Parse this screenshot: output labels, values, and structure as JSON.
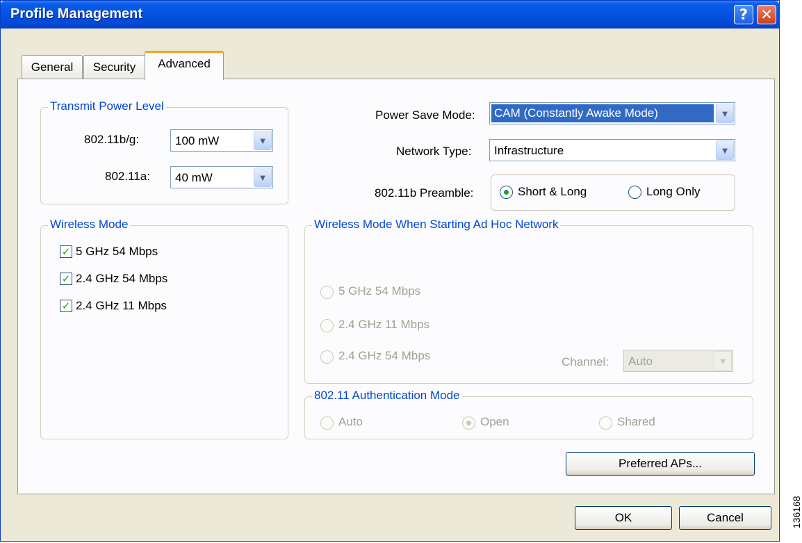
{
  "window": {
    "title": "Profile Management",
    "help_label": "?",
    "close_label": "✕"
  },
  "tabs": [
    {
      "label": "General"
    },
    {
      "label": "Security"
    },
    {
      "label": "Advanced",
      "active": true
    }
  ],
  "transmit_power": {
    "title": "Transmit Power Level",
    "bg_label": "802.11b/g:",
    "bg_value": "100 mW",
    "a_label": "802.11a:",
    "a_value": "40 mW"
  },
  "power_save": {
    "label": "Power Save Mode:",
    "value": "CAM (Constantly Awake Mode)"
  },
  "network_type": {
    "label": "Network Type:",
    "value": "Infrastructure"
  },
  "preamble": {
    "label": "802.11b Preamble:",
    "options": [
      {
        "label": "Short & Long",
        "checked": true
      },
      {
        "label": "Long Only",
        "checked": false
      }
    ]
  },
  "wireless_mode": {
    "title": "Wireless Mode",
    "items": [
      {
        "label": "5 GHz 54 Mbps",
        "checked": true
      },
      {
        "label": "2.4 GHz 54 Mbps",
        "checked": true
      },
      {
        "label": "2.4 GHz 11 Mbps",
        "checked": true
      }
    ]
  },
  "adhoc_mode": {
    "title": "Wireless Mode When Starting Ad Hoc Network",
    "options": [
      {
        "label": "5 GHz 54 Mbps"
      },
      {
        "label": "2.4 GHz 11 Mbps"
      },
      {
        "label": "2.4 GHz 54 Mbps"
      }
    ],
    "channel_label": "Channel:",
    "channel_value": "Auto"
  },
  "auth_mode": {
    "title": "802.11 Authentication Mode",
    "options": [
      {
        "label": "Auto",
        "checked": false
      },
      {
        "label": "Open",
        "checked": true
      },
      {
        "label": "Shared",
        "checked": false
      }
    ]
  },
  "buttons": {
    "preferred_aps": "Preferred APs...",
    "ok": "OK",
    "cancel": "Cancel"
  },
  "figure_number": "136168"
}
